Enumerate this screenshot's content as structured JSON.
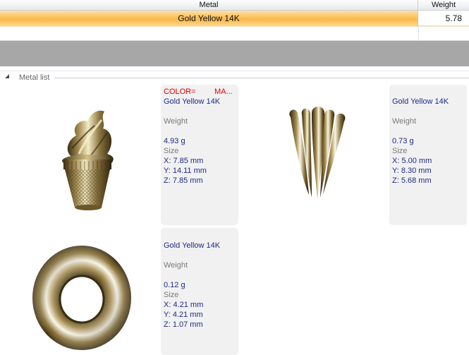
{
  "grid": {
    "headers": {
      "metal": "Metal",
      "weight": "Weight"
    },
    "rows": [
      {
        "metal": "Gold Yellow 14K",
        "weight": "5.78"
      }
    ]
  },
  "metal_list": {
    "group_label": "Metal list",
    "items": [
      {
        "color_label": "COLOR=",
        "material_label": "MA...",
        "metal": "Gold Yellow 14K",
        "weight_label": "Weight",
        "weight": "4.93 g",
        "size_label": "Size",
        "x": "X: 7.85 mm",
        "y": "Y: 14.11 mm",
        "z": "Z: 7.85 mm",
        "image_icon": "ice-cream-cone-charm-icon"
      },
      {
        "metal": "Gold Yellow 14K",
        "weight_label": "Weight",
        "weight": "0.73 g",
        "size_label": "Size",
        "x": "X: 5.00 mm",
        "y": "Y: 8.30 mm",
        "z": "Z: 5.68 mm",
        "image_icon": "fluted-pendant-icon"
      },
      {
        "metal": "Gold Yellow 14K",
        "weight_label": "Weight",
        "weight": "0.12 g",
        "size_label": "Size",
        "x": "X: 4.21 mm",
        "y": "Y: 4.21 mm",
        "z": "Z: 1.07 mm",
        "image_icon": "ring-donut-icon"
      }
    ]
  },
  "colors": {
    "selection": "#f9b84b",
    "text_blue": "#1f2a86",
    "red": "#e00000",
    "band": "#a7a7a7",
    "card": "#f1f1f1",
    "gold": "#c8b060"
  }
}
